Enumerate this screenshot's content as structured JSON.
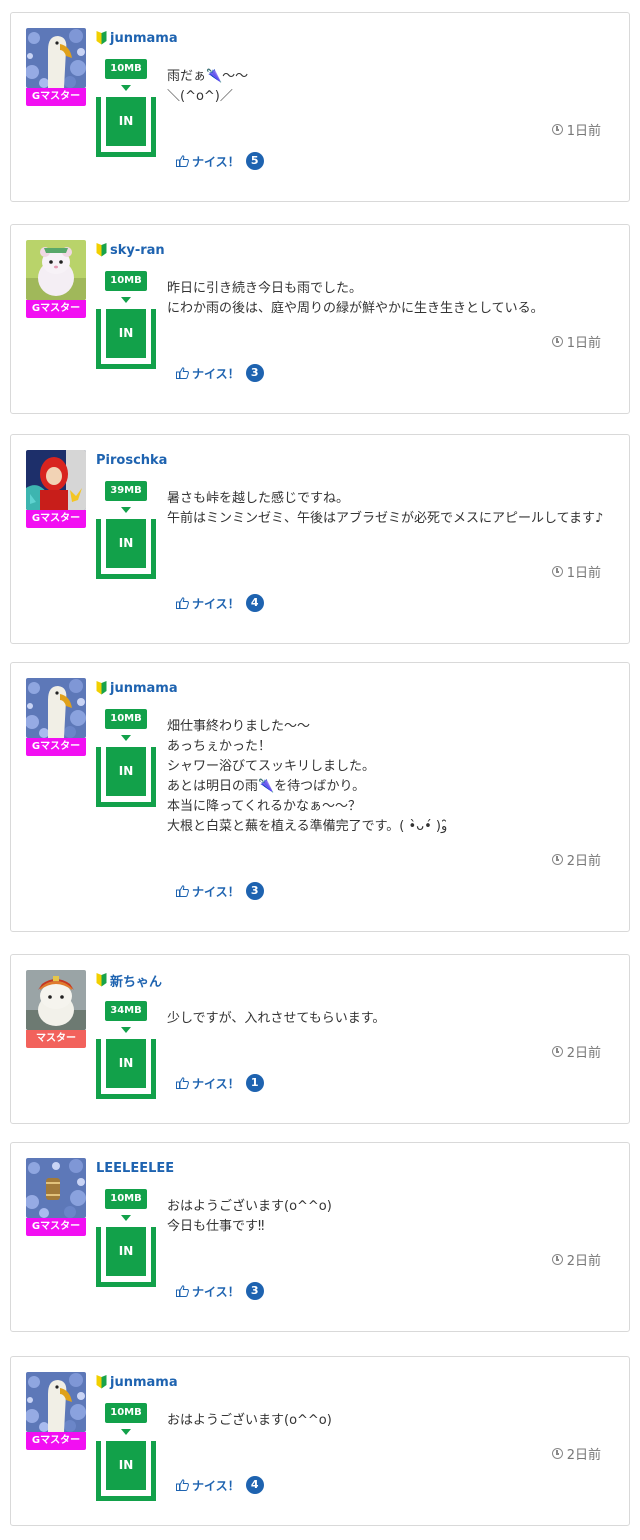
{
  "colors": {
    "accent_green": "#12a14a",
    "link_blue": "#1e63b0",
    "g_master": "#f20ff2",
    "master": "#f2625c"
  },
  "posts": [
    {
      "avatar_icon": "swan-avatar",
      "beginner_mark": true,
      "username": "junmama",
      "rank": "Gマスター",
      "data_size": "10MB",
      "in_label": "IN",
      "message": "雨だぁ🌂〜〜\n＼(^o^)／",
      "time": "1日前",
      "nice_label": "ナイス！",
      "nice_count": "5"
    },
    {
      "avatar_icon": "hamster-avatar",
      "beginner_mark": true,
      "username": "sky-ran",
      "rank": "Gマスター",
      "data_size": "10MB",
      "in_label": "IN",
      "message": "昨日に引き続き今日も雨でした。\nにわか雨の後は、庭や周りの緑が鮮やかに生き生きとしている。",
      "time": "1日前",
      "nice_label": "ナイス！",
      "nice_count": "3"
    },
    {
      "avatar_icon": "doll-avatar",
      "beginner_mark": false,
      "username": "Piroschka",
      "rank": "Gマスター",
      "data_size": "39MB",
      "in_label": "IN",
      "message": "暑さも峠を越した感じですね。\n午前はミンミンゼミ、午後はアブラゼミが必死でメスにアピールしてます♪",
      "time": "1日前",
      "nice_label": "ナイス！",
      "nice_count": "4"
    },
    {
      "avatar_icon": "swan-avatar",
      "beginner_mark": true,
      "username": "junmama",
      "rank": "Gマスター",
      "data_size": "10MB",
      "in_label": "IN",
      "message": "畑仕事終わりました〜〜\nあっちぇかった！\nシャワー浴びてスッキリしました。\nあとは明日の雨🌂を待つばかり。\n本当に降ってくれるかなぁ〜〜？\n大根と白菜と蕪を植える準備完了です。( •̀ᴗ•́ )و ̑̑",
      "time": "2日前",
      "nice_label": "ナイス！",
      "nice_count": "3"
    },
    {
      "avatar_icon": "samurai-cat-avatar",
      "beginner_mark": true,
      "username": "新ちゃん",
      "rank": "マスター",
      "data_size": "34MB",
      "in_label": "IN",
      "message": "少しですが、入れさせてもらいます。",
      "time": "2日前",
      "nice_label": "ナイス！",
      "nice_count": "1"
    },
    {
      "avatar_icon": "flowers-barrel-avatar",
      "beginner_mark": false,
      "username": "LEELEELEE",
      "rank": "Gマスター",
      "data_size": "10MB",
      "in_label": "IN",
      "message": "おはようございます(o^^o)\n今日も仕事です‼︎",
      "time": "2日前",
      "nice_label": "ナイス！",
      "nice_count": "3"
    },
    {
      "avatar_icon": "swan-avatar",
      "beginner_mark": true,
      "username": "junmama",
      "rank": "Gマスター",
      "data_size": "10MB",
      "in_label": "IN",
      "message": "おはようございます(o^^o)",
      "time": "2日前",
      "nice_label": "ナイス！",
      "nice_count": "4"
    }
  ]
}
